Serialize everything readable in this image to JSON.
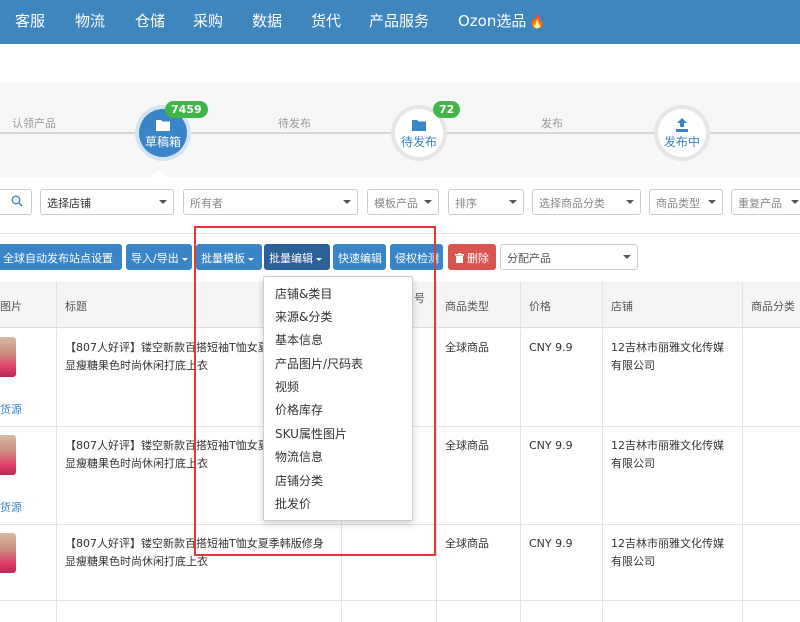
{
  "nav": {
    "items": [
      "客服",
      "物流",
      "仓储",
      "采购",
      "数据",
      "货代",
      "产品服务",
      "Ozon选品"
    ],
    "hot_icon": "fire-icon"
  },
  "steps": {
    "labels": {
      "claim": "认领产品",
      "pending": "待发布",
      "publish": "发布"
    },
    "draft": {
      "label": "草稿箱",
      "count": "7459"
    },
    "to_publish": {
      "label": "待发布",
      "count": "72"
    },
    "publishing": {
      "label": "发布中"
    }
  },
  "filters": {
    "select_shop": "选择店铺",
    "owner": "所有者",
    "template": "模板产品",
    "sort": "排序",
    "category": "选择商品分类",
    "product_type": "商品类型",
    "duplicate": "重复产品"
  },
  "toolbar": {
    "auto_publish": "全球自动发布站点设置",
    "import_export": "导入/导出",
    "batch_template": "批量模板",
    "batch_edit": "批量编辑",
    "quick_edit": "快速编辑",
    "infringement": "侵权检测",
    "delete": "删除",
    "assign": "分配产品"
  },
  "table": {
    "headers": {
      "image": "图片",
      "title": "标题",
      "sku": "号",
      "type": "商品类型",
      "price": "价格",
      "shop": "店铺",
      "category": "商品分类"
    },
    "rows": [
      {
        "title": "【807人好评】镂空新款百搭短袖T恤女夏季韩版修身显瘦糖果色时尚休闲打底上衣",
        "type": "全球商品",
        "price": "CNY 9.9",
        "shop": "12吉林市丽雅文化传媒有限公司",
        "source": "货源"
      },
      {
        "title": "【807人好评】镂空新款百搭短袖T恤女夏季韩版修身显瘦糖果色时尚休闲打底上衣",
        "type": "全球商品",
        "price": "CNY 9.9",
        "shop": "12吉林市丽雅文化传媒有限公司",
        "source": "货源"
      },
      {
        "title": "【807人好评】镂空新款百搭短袖T恤女夏季韩版修身显瘦糖果色时尚休闲打底上衣",
        "type": "全球商品",
        "price": "CNY 9.9",
        "shop": "12吉林市丽雅文化传媒有限公司",
        "source": ""
      }
    ]
  },
  "dropdown": {
    "items": [
      "店铺&类目",
      "来源&分类",
      "基本信息",
      "产品图片/尺码表",
      "视频",
      "价格库存",
      "SKU属性图片",
      "物流信息",
      "店铺分类",
      "批发价"
    ]
  },
  "colors": {
    "nav": "#3f86bf",
    "button": "#3a85c8",
    "active_button": "#2d5f99",
    "delete": "#d9534f",
    "badge": "#41b548",
    "highlight": "#e53935"
  }
}
